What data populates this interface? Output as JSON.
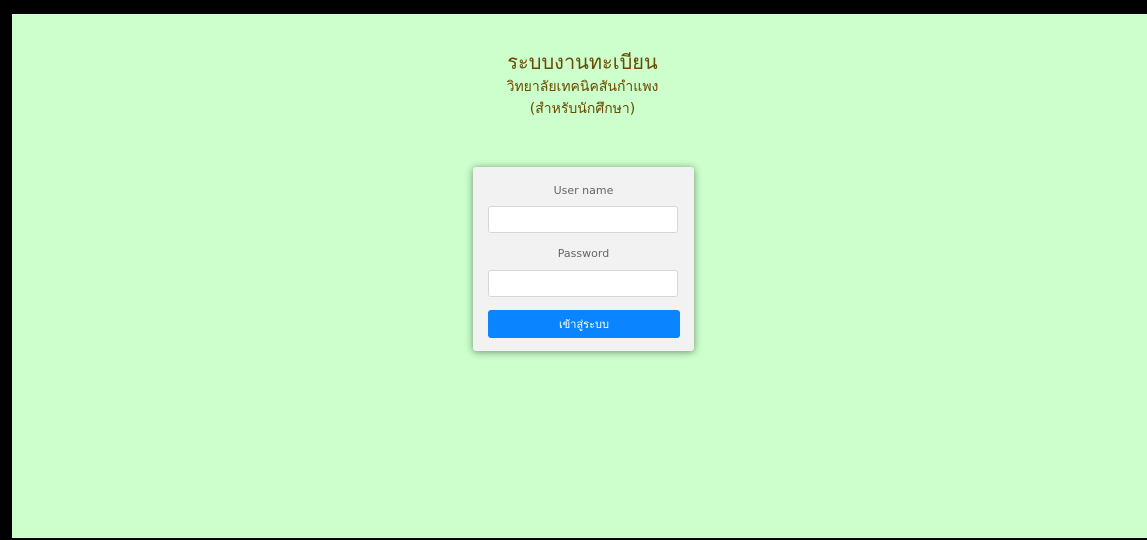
{
  "header": {
    "title": "ระบบงานทะเบียน",
    "subtitle": "วิทยาลัยเทคนิคสันกำแพง",
    "note": "(สำหรับนักศึกษา)"
  },
  "login": {
    "username_label": "User name",
    "username_value": "",
    "password_label": "Password",
    "password_value": "",
    "submit_label": "เข้าสู่ระบบ"
  },
  "colors": {
    "background": "#ccffcc",
    "title_text": "#6a4a00",
    "button": "#0a84ff",
    "card": "#f2f2f2"
  }
}
